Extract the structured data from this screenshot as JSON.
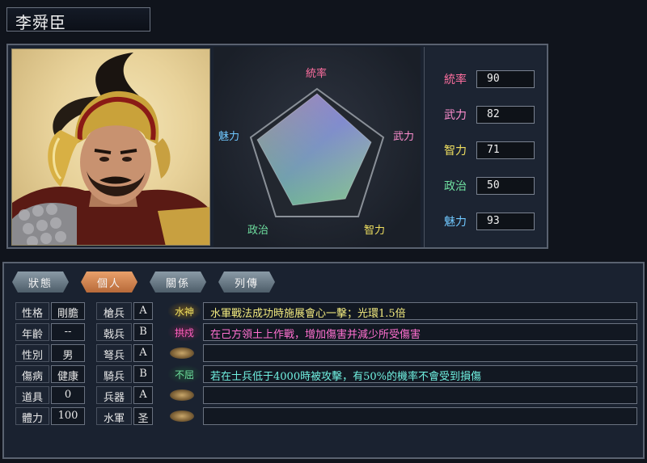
{
  "officer": {
    "name": "李舜臣"
  },
  "radar": {
    "labels": {
      "lead": "統率",
      "war": "武力",
      "int": "智力",
      "pol": "政治",
      "chr": "魅力"
    }
  },
  "stats": [
    {
      "label": "統率",
      "value": "90",
      "color": "#ff6fa0"
    },
    {
      "label": "武力",
      "value": "82",
      "color": "#ff8fd0"
    },
    {
      "label": "智力",
      "value": "71",
      "color": "#f0e060"
    },
    {
      "label": "政治",
      "value": "50",
      "color": "#6fe0a0"
    },
    {
      "label": "魅力",
      "value": "93",
      "color": "#70c8ff"
    }
  ],
  "tabs": [
    {
      "label": "狀態",
      "active": false
    },
    {
      "label": "個人",
      "active": true
    },
    {
      "label": "關係",
      "active": false
    },
    {
      "label": "列傳",
      "active": false
    }
  ],
  "personal": [
    {
      "label": "性格",
      "value": "剛膽"
    },
    {
      "label": "年齡",
      "value": "--"
    },
    {
      "label": "性別",
      "value": "男"
    },
    {
      "label": "傷病",
      "value": "健康"
    },
    {
      "label": "道具",
      "value": "0"
    },
    {
      "label": "體力",
      "value": "100"
    }
  ],
  "aptitude": [
    {
      "label": "槍兵",
      "value": "A"
    },
    {
      "label": "戟兵",
      "value": "B"
    },
    {
      "label": "弩兵",
      "value": "A"
    },
    {
      "label": "騎兵",
      "value": "B"
    },
    {
      "label": "兵器",
      "value": "A"
    },
    {
      "label": "水軍",
      "value": "圣"
    }
  ],
  "skills": [
    {
      "name": "水神",
      "color": "#f0e060",
      "desc": "水軍戰法成功時施展會心一擊；光環1.5倍",
      "desc_color": "#f4ec80"
    },
    {
      "name": "拱戍",
      "color": "#ff60c0",
      "desc": "在己方領土上作戰，增加傷害并減少所受傷害",
      "desc_color": "#ff70d0"
    },
    {
      "name": "",
      "color": "",
      "desc": "",
      "desc_color": ""
    },
    {
      "name": "不屈",
      "color": "#70e0a0",
      "desc": "若在士兵低于4000時被攻擊，有50%的機率不會受到損傷",
      "desc_color": "#70f0e0"
    },
    {
      "name": "",
      "color": "",
      "desc": "",
      "desc_color": ""
    },
    {
      "name": "",
      "color": "",
      "desc": "",
      "desc_color": ""
    }
  ]
}
